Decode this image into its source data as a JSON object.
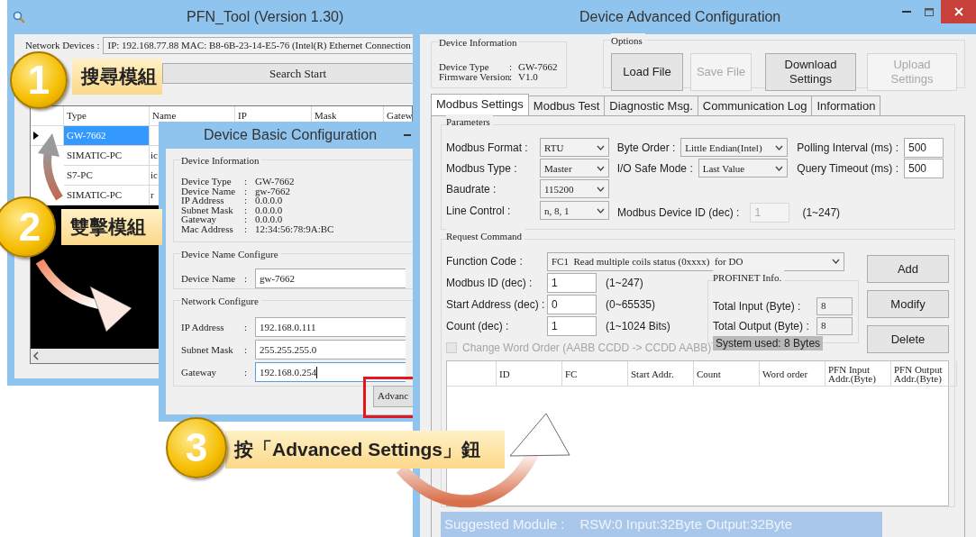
{
  "pfn_window": {
    "title": "PFN_Tool (Version 1.30)",
    "network_label": "Network Devices :",
    "network_value": "IP: 192.168.77.88  MAC: B8-6B-23-14-E5-76 (Intel(R) Ethernet Connection",
    "search_button": "Search Start",
    "columns": [
      "Type",
      "Name",
      "IP",
      "Mask",
      "Gatew"
    ],
    "rows": [
      {
        "type": "GW-7662",
        "selected": true
      },
      {
        "type": "SIMATIC-PC",
        "name": "ic",
        "selected": false
      },
      {
        "type": "S7-PC",
        "name": "ic",
        "selected": false
      },
      {
        "type": "SIMATIC-PC",
        "name": "r",
        "selected": false
      }
    ]
  },
  "basic_dialog": {
    "title": "Device Basic Configuration",
    "info_title": "Device Information",
    "info": [
      {
        "label": "Device Type",
        "sep": ":",
        "value": "GW-7662"
      },
      {
        "label": "Device Name",
        "sep": ":",
        "value": "gw-7662"
      },
      {
        "label": "IP Address",
        "sep": ":",
        "value": "0.0.0.0"
      },
      {
        "label": "Subnet Mask",
        "sep": ":",
        "value": "0.0.0.0"
      },
      {
        "label": "Gateway",
        "sep": ":",
        "value": "0.0.0.0"
      },
      {
        "label": "Mac Address",
        "sep": ":",
        "value": "12:34:56:78:9A:BC"
      }
    ],
    "name_group": "Device Name Configure",
    "name_field": {
      "label": "Device Name",
      "sep": ":",
      "value": "gw-7662"
    },
    "network_group": "Network Configure",
    "network_fields": [
      {
        "label": "IP Address",
        "sep": ":",
        "value": "192.168.0.111",
        "focused": false
      },
      {
        "label": "Subnet Mask",
        "sep": ":",
        "value": "255.255.255.0",
        "focused": false
      },
      {
        "label": "Gateway",
        "sep": ":",
        "value": "192.168.0.254",
        "focused": true
      }
    ],
    "advanced_button": "Advanc"
  },
  "advanced_window": {
    "title": "Device Advanced Configuration",
    "info_title": "Device Information",
    "info": [
      {
        "label": "Device Type",
        "sep": ":",
        "value": "GW-7662"
      },
      {
        "label": "Firmware Version",
        "sep": ":",
        "value": "V1.0"
      }
    ],
    "options_title": "Options",
    "option_buttons": [
      {
        "label": "Load File",
        "disabled": false
      },
      {
        "label": "Save File",
        "disabled": true
      },
      {
        "label": "Download Settings",
        "disabled": false
      },
      {
        "label": "Upload Settings",
        "disabled": true
      }
    ],
    "tabs": [
      {
        "label": "Modbus Settings",
        "selected": true
      },
      {
        "label": "Modbus Test",
        "selected": false
      },
      {
        "label": "Diagnostic Msg.",
        "selected": false
      },
      {
        "label": "Communication Log",
        "selected": false
      },
      {
        "label": "Information",
        "selected": false
      }
    ],
    "parameters": {
      "title": "Parameters",
      "rows": [
        [
          {
            "label": "Modbus Format :",
            "kind": "select",
            "value": "RTU"
          },
          {
            "label": "Byte Order :",
            "kind": "select",
            "value": "Little Endian(Intel)"
          },
          {
            "label": "Polling Interval (ms) :",
            "kind": "input",
            "value": "500"
          }
        ],
        [
          {
            "label": "Modbus Type :",
            "kind": "select",
            "value": "Master"
          },
          {
            "label": "I/O Safe Mode :",
            "kind": "select",
            "value": "Last Value"
          },
          {
            "label": "Query Timeout (ms) :",
            "kind": "input",
            "value": "500"
          }
        ],
        [
          {
            "label": "Baudrate :",
            "kind": "select",
            "value": "115200"
          }
        ],
        [
          {
            "label": "Line Control :",
            "kind": "select",
            "value": "n, 8, 1"
          },
          {
            "label": "Modbus Device ID (dec) :",
            "kind": "input",
            "value": "1",
            "disabled": true,
            "hint": "(1~247)"
          }
        ]
      ]
    },
    "request": {
      "title": "Request Command",
      "function_code": {
        "label": "Function Code :",
        "value": "FC1  Read multiple coils status (0xxxx)  for DO"
      },
      "fields": [
        {
          "label": "Modbus ID (dec) :",
          "value": "1",
          "hint": "(1~247)"
        },
        {
          "label": "Start Address (dec) :",
          "value": "0",
          "hint": "(0~65535)"
        },
        {
          "label": "Count (dec) :",
          "value": "1",
          "hint": "(1~1024 Bits)"
        }
      ],
      "profinet": {
        "title": "PROFINET Info.",
        "fields": [
          {
            "label": "Total Input (Byte) :",
            "value": "8"
          },
          {
            "label": "Total Output (Byte) :",
            "value": "8"
          }
        ],
        "system_used": "System used: 8 Bytes"
      },
      "buttons": [
        "Add",
        "Modify",
        "Delete"
      ],
      "checkbox": {
        "label": "Change Word Order (AABB CCDD -> CCDD AABB)",
        "checked": false,
        "disabled": true
      },
      "columns": [
        "ID",
        "FC",
        "Start Addr.",
        "Count",
        "Word order",
        "PFN Input Addr.(Byte)",
        "PFN Output Addr.(Byte)"
      ]
    },
    "suggested_label": "Suggested Module :",
    "suggested_value": "RSW:0 Input:32Byte Output:32Byte"
  },
  "callouts": [
    {
      "number": "1",
      "text": "搜尋模組"
    },
    {
      "number": "2",
      "text": "雙擊模組"
    },
    {
      "number": "3",
      "text": "按「Advanced Settings」鈕"
    }
  ]
}
